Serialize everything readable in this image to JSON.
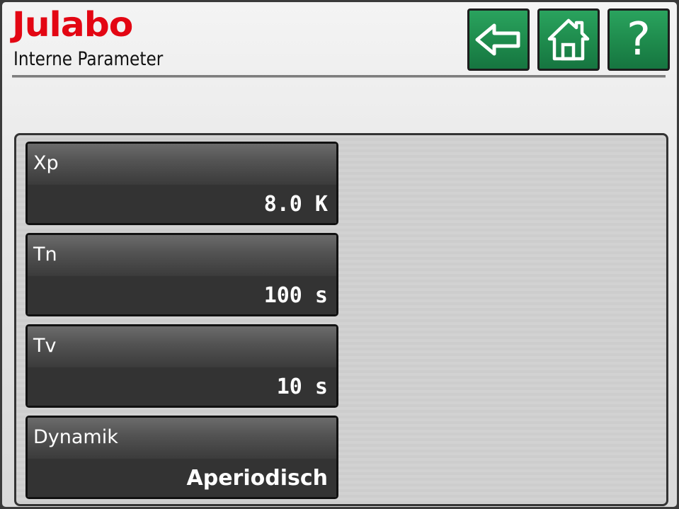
{
  "header": {
    "logo_text": "Julabo",
    "page_title": "Interne Parameter"
  },
  "nav": {
    "back_icon": "arrow-left-icon",
    "home_icon": "home-icon",
    "help_label": "?"
  },
  "colors": {
    "brand_red": "#e30613",
    "nav_green": "#1e8a4c"
  },
  "parameters": [
    {
      "name": "Xp",
      "value": "8.0 K"
    },
    {
      "name": "Tn",
      "value": "100 s"
    },
    {
      "name": "Tv",
      "value": "10 s"
    },
    {
      "name": "Dynamik",
      "value": "Aperiodisch"
    }
  ]
}
